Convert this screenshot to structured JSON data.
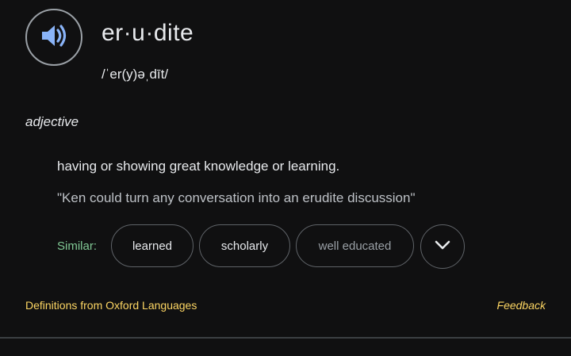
{
  "entry": {
    "word": "er·u·dite",
    "phonetic": "/ˈer(y)əˌdīt/",
    "part_of_speech": "adjective",
    "definition": "having or showing great knowledge or learning.",
    "example": "\"Ken could turn any conversation into an erudite discussion\""
  },
  "similar": {
    "label": "Similar:",
    "chips": [
      "learned",
      "scholarly",
      "well educated"
    ]
  },
  "footer": {
    "source": "Definitions from Oxford Languages",
    "feedback": "Feedback"
  },
  "icons": {
    "speaker": "speaker-icon",
    "expand": "chevron-down-icon"
  },
  "colors": {
    "background": "#101011",
    "speaker_accent": "#8ab4f8",
    "similar_label": "#81c995",
    "link": "#fdd663",
    "chip_border": "#5f6368"
  }
}
